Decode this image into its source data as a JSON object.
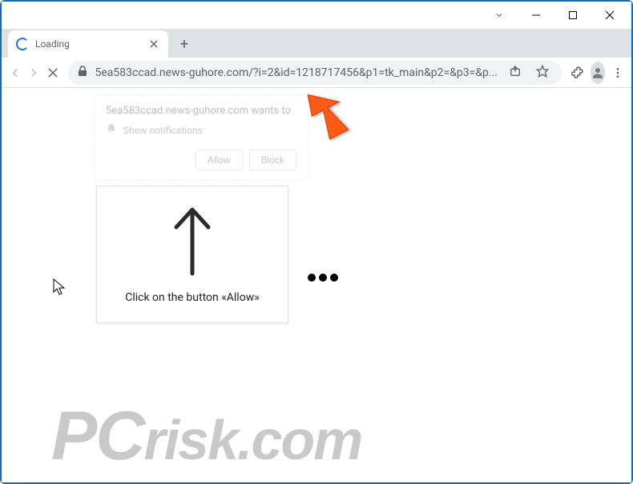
{
  "window": {
    "tab_title": "Loading"
  },
  "toolbar": {
    "url": "5ea583ccad.news-guhore.com/?i=2&id=1218717456&p1=tk_main&p2=&p3=&p..."
  },
  "notification": {
    "origin": "5ea583ccad.news-guhore.com wants to",
    "sub": "Show notifications",
    "allow": "Allow",
    "block": "Block"
  },
  "instruction": {
    "text": "Click on the button «Allow»"
  },
  "watermark": {
    "text": "PCrisk.com"
  }
}
